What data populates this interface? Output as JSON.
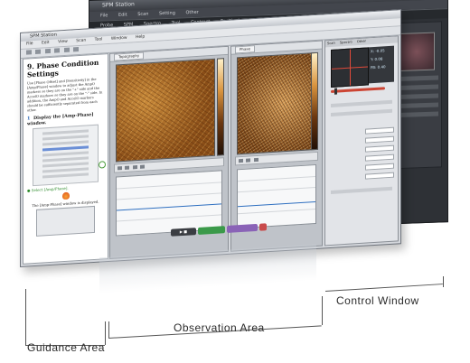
{
  "back_window": {
    "title": "SPM Station",
    "menu": [
      "File",
      "Edit",
      "Scan",
      "Setting",
      "Other"
    ],
    "toolbar": [
      "Probe",
      "SPM",
      "Spectro",
      "Tool",
      "Contrast",
      "Positioning"
    ],
    "readout": [
      "X: -0.05",
      "Y: 0.08",
      "FB: 0.40"
    ]
  },
  "front_window": {
    "title": "SPM Station",
    "menu": [
      "File",
      "Edit",
      "View",
      "Scan",
      "Tool",
      "Window",
      "Help"
    ],
    "obs_tab_a": "Topography",
    "obs_tab_b": "Phase",
    "ctrl_tabs": [
      "Scan",
      "Spectro",
      "Other"
    ],
    "readout": [
      "X: -0.05",
      "Y: 0.08",
      "FB: 0.40"
    ]
  },
  "guidance": {
    "title": "9. Phase Condition Settings",
    "paragraph": "Use [Phase Offset] and [Sensitivity] in the [Amp/Phase] window to adjust the AmpO markers so they are on the \"+\" side and the AccelO markers so they are on the \"-\" side. In addition, the AmpO and AccelO markers should be sufficiently separated from each other.",
    "step1": "Display the [Amp-Phase] window.",
    "step1_num": "1",
    "step2": "Select [Amp/Phase].",
    "caption": "The [Amp-Phase] window is displayed."
  },
  "labels": {
    "guidance": "Guidance Area",
    "observation": "Observation Area",
    "control": "Control Window"
  },
  "colors": {
    "accent_blue": "#2e6fc0",
    "green_button": "#3b9a4a",
    "purple_button": "#8a63b7",
    "red_button": "#c94b4b"
  }
}
